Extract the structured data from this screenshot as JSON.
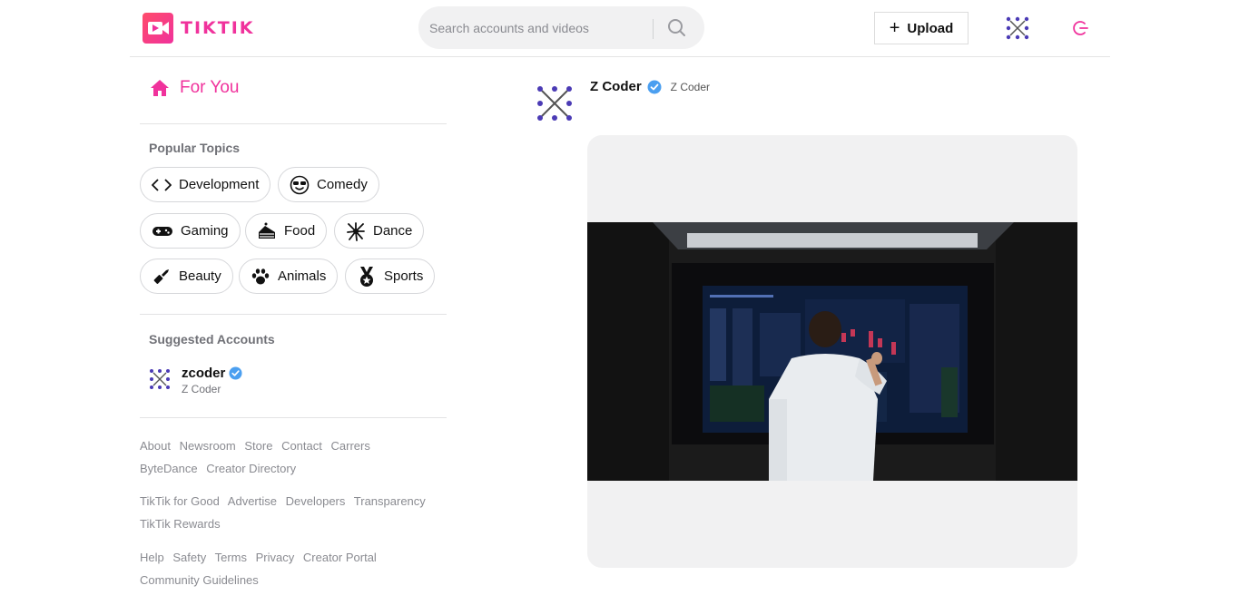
{
  "header": {
    "logo_text": "TIKTIK",
    "search_placeholder": "Search accounts and videos",
    "upload_label": "Upload"
  },
  "sidebar": {
    "for_you_label": "For You",
    "popular_topics_title": "Popular Topics",
    "topics": [
      {
        "label": "Development",
        "icon": "code-icon"
      },
      {
        "label": "Comedy",
        "icon": "sunglasses-face-icon"
      },
      {
        "label": "Gaming",
        "icon": "gamepad-icon"
      },
      {
        "label": "Food",
        "icon": "cake-icon"
      },
      {
        "label": "Dance",
        "icon": "dancer-icon"
      },
      {
        "label": "Beauty",
        "icon": "lipstick-icon"
      },
      {
        "label": "Animals",
        "icon": "paw-icon"
      },
      {
        "label": "Sports",
        "icon": "medal-icon"
      }
    ],
    "suggested_title": "Suggested Accounts",
    "suggested_accounts": [
      {
        "name": "zcoder",
        "subtitle": "Z Coder",
        "verified": true
      }
    ],
    "footer_groups": [
      [
        "About",
        "Newsroom",
        "Store",
        "Contact",
        "Carrers",
        "ByteDance",
        "Creator Directory"
      ],
      [
        "TikTik for Good",
        "Advertise",
        "Developers",
        "Transparency",
        "TikTik Rewards"
      ],
      [
        "Help",
        "Safety",
        "Terms",
        "Privacy",
        "Creator Portal",
        "Community Guidelines"
      ]
    ]
  },
  "post": {
    "username": "Z Coder",
    "handle": "Z Coder",
    "verified": true
  },
  "colors": {
    "brand": "#f0329c",
    "verified": "#4b9ff0",
    "avatar_dot": "#4b3bb5"
  }
}
